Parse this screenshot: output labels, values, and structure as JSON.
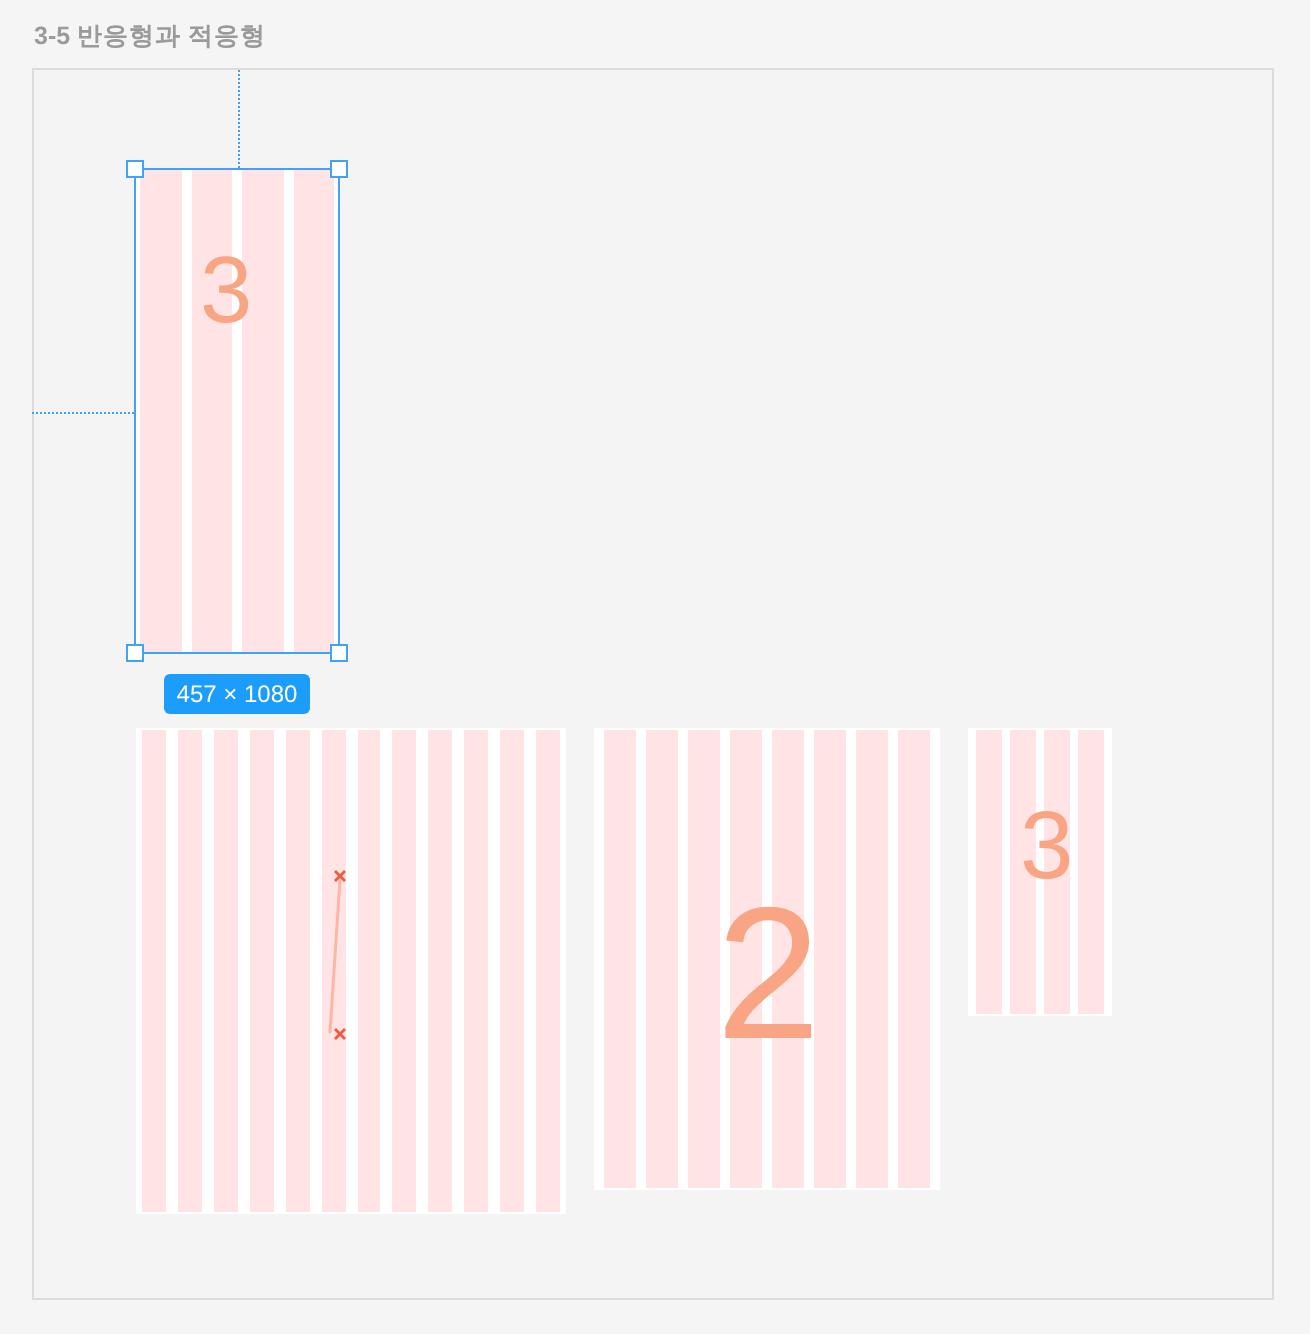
{
  "title": "3-5 반응형과 적응형",
  "frames": [
    {
      "selected": true,
      "kind": "digit",
      "digit": "3",
      "size_label": "457 × 1080"
    },
    {
      "selected": false,
      "kind": "path"
    },
    {
      "selected": false,
      "kind": "digit",
      "digit": "2"
    },
    {
      "selected": false,
      "kind": "digit",
      "digit": "3"
    }
  ]
}
